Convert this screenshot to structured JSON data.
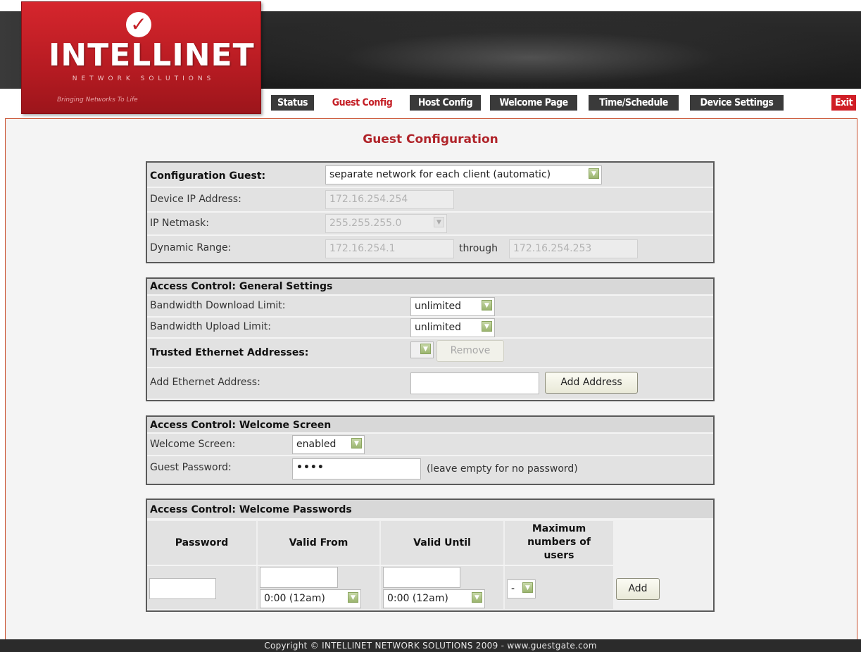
{
  "brand": {
    "name": "INTELLINET",
    "subline": "NETWORK SOLUTIONS",
    "tagline": "Bringing Networks To Life"
  },
  "nav": {
    "status": "Status",
    "guest_config": "Guest Config",
    "host_config": "Host Config",
    "welcome_page": "Welcome Page",
    "time_schedule": "Time/Schedule",
    "device_settings": "Device Settings",
    "exit": "Exit",
    "active": "Guest Config"
  },
  "page_title": "Guest Configuration",
  "guest": {
    "config_label": "Configuration Guest:",
    "config_value": "separate network for each client (automatic)",
    "device_ip_label": "Device IP Address:",
    "device_ip_value": "172.16.254.254",
    "netmask_label": "IP Netmask:",
    "netmask_value": "255.255.255.0",
    "range_label": "Dynamic Range:",
    "range_from": "172.16.254.1",
    "range_through_label": "through",
    "range_to": "172.16.254.253"
  },
  "general": {
    "header": "Access Control: General Settings",
    "download_label": "Bandwidth Download Limit:",
    "download_value": "unlimited",
    "upload_label": "Bandwidth Upload Limit:",
    "upload_value": "unlimited",
    "trusted_label": "Trusted Ethernet Addresses:",
    "remove_button": "Remove",
    "add_eth_label": "Add Ethernet Address:",
    "add_eth_value": "",
    "add_address_button": "Add Address"
  },
  "welcome": {
    "header": "Access Control: Welcome Screen",
    "screen_label": "Welcome Screen:",
    "screen_value": "enabled",
    "password_label": "Guest Password:",
    "password_value": "••••",
    "password_hint": "(leave empty for no password)"
  },
  "passwords": {
    "header": "Access Control: Welcome Passwords",
    "col_password": "Password",
    "col_valid_from": "Valid From",
    "col_valid_until": "Valid Until",
    "col_max_users": "Maximum numbers of users",
    "valid_from_time": "0:00 (12am)",
    "valid_until_time": "0:00 (12am)",
    "max_users_value": "-",
    "add_button": "Add"
  },
  "footer": "Copyright © INTELLINET NETWORK SOLUTIONS 2009 - www.guestgate.com",
  "colors": {
    "brand_red": "#c41e25",
    "title_red": "#b0242a",
    "nav_dark": "#3a3a3a"
  }
}
